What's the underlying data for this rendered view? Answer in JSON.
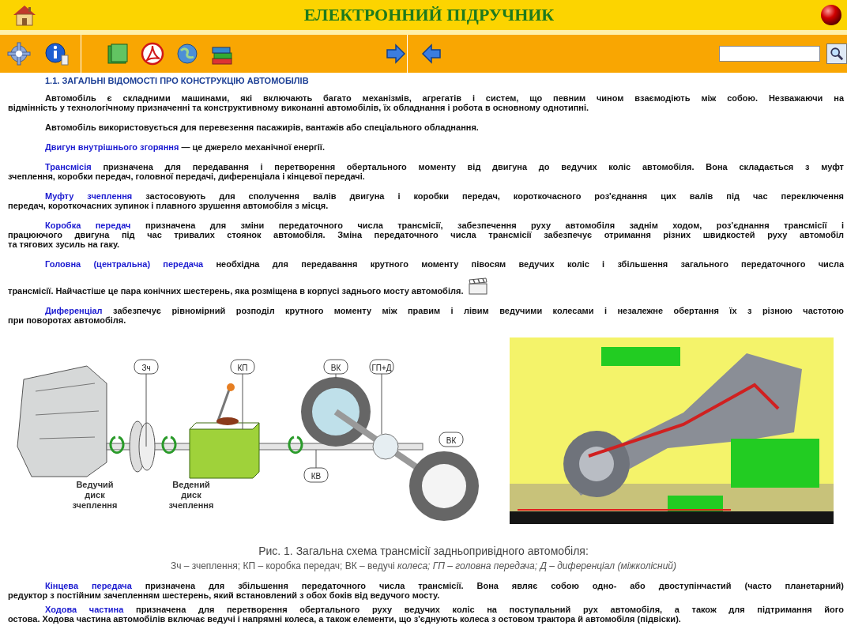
{
  "header": {
    "title": "ЕЛЕКТРОННИЙ ПІДРУЧНИК"
  },
  "section_title": "1.1. ЗАГАЛЬНІ ВІДОМОСТІ ПРО КОНСТРУКЦІЮ АВТОМОБІЛІВ",
  "paragraphs": [
    {
      "kind": "text",
      "lines": [
        "Автомобіль є складними машинами, які включають багато механізмів, агрегатів і систем, що певним чином взаємодіють між собою. Незважаючи на",
        "відмінність у технологічному призначенні та конструктивному виконанні автомобілів, їх обладнання і робота в основному однотипні."
      ]
    },
    {
      "kind": "text",
      "lines": [
        "Автомобіль використовується для перевезення пасажирів, вантажів або спеціального обладнання."
      ]
    },
    {
      "kind": "text",
      "term": "Двигун внутрішнього згоряння",
      "lines": [
        " — це джерело механічної енергії."
      ]
    },
    {
      "kind": "text",
      "term": "Трансмісія",
      "lines": [
        " призначена для передавання і перетворення обертального моменту від двигуна до ведучих коліс автомобіля. Вона складається з муфт",
        "зчеплення, коробки передач, головної передачі, диференціала і кінцевої передачі."
      ]
    },
    {
      "kind": "text",
      "term": "Муфту зчеплення",
      "lines": [
        " застосовують для сполучення валів двигуна і коробки передач, короткочасного роз'єднання цих валів під час переключення",
        "передач, короткочасних зупинок і плавного зрушення автомобіля з місця."
      ]
    },
    {
      "kind": "text",
      "term": "Коробка передач",
      "lines": [
        " призначена для зміни передаточного числа трансмісії, забезпечення руху автомобіля заднім ходом, роз'єднання трансмісії і",
        "працюючого двигуна під час тривалих стоянок автомобіля. Зміна передаточного числа трансмісії забезпечує отримання різних швидкостей руху автомобіл",
        "та тягових зусиль на гаку."
      ]
    },
    {
      "kind": "video",
      "term": "Головна (центральна) передача",
      "lines": [
        " необхідна для передавання крутного моменту півосям ведучих коліс і збільшення загального передаточного числа",
        "трансмісії. Найчастіше це пара конічних шестерень, яка розміщена в корпусі заднього мосту автомобіля."
      ]
    },
    {
      "kind": "text",
      "term": "Диференціал",
      "lines": [
        " забезпечує рівномірний розподіл крутного моменту між правим і лівим ведучими колесами і незалежне обертання їх з різною частотою",
        "при поворотах автомобіля."
      ]
    }
  ],
  "figure": {
    "diagram_labels": [
      "Зч",
      "КП",
      "ВК",
      "ГП+Д",
      "ВК",
      "КВ"
    ],
    "disc_labels": [
      "Ведучий диск зчеплення",
      "Ведений диск зчеплення"
    ],
    "video": {
      "kind": "picture"
    },
    "caption": "Рис. 1. Загальна схема трансмісії задньопривідного автомобіля:",
    "legend": "Зч – зчеплення; КП – коробка передач; ВК – ведучі *колеса; ГП – головна передача; Д – диференціал (міжколісний)*"
  },
  "paragraphs_after": [
    {
      "term": "Кінцева передача",
      "lines": [
        " призначена для збільшення передаточного числа трансмісії. Вона являє собою одно- або двоступінчастий (часто планетарний)",
        "редуктор з постійним зачепленням шестерень, який встановлений з обох боків від ведучого мосту."
      ]
    },
    {
      "term": "Ходова частина",
      "lines": [
        " призначена для перетворення обертального руху ведучих коліс на поступальний рух автомобіля, а також для підтримання його",
        "остова. Ходова частина автомобілів включає ведучі і напрямні колеса, а також елементи, що з'єднують колеса з остовом трактора й автомобіля (підвіски)."
      ]
    }
  ]
}
